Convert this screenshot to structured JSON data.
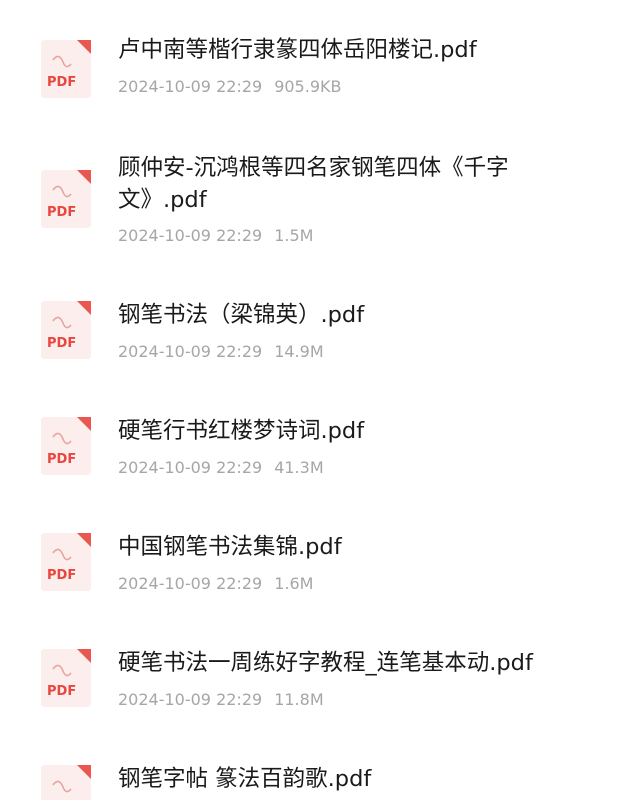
{
  "icon_name": "pdf-file-icon",
  "icon_label": "PDF",
  "colors": {
    "accent": "#e8463f",
    "title": "#1a1a1a",
    "meta": "#a6a6a6"
  },
  "files": [
    {
      "name": "卢中南等楷行隶篆四体岳阳楼记.pdf",
      "date": "2024-10-09 22:29",
      "size": "905.9KB"
    },
    {
      "name": "顾仲安-沉鸿根等四名家钢笔四体《千字文》.pdf",
      "date": "2024-10-09 22:29",
      "size": "1.5M"
    },
    {
      "name": "钢笔书法（梁锦英）.pdf",
      "date": "2024-10-09 22:29",
      "size": "14.9M"
    },
    {
      "name": "硬笔行书红楼梦诗词.pdf",
      "date": "2024-10-09 22:29",
      "size": "41.3M"
    },
    {
      "name": "中国钢笔书法集锦.pdf",
      "date": "2024-10-09 22:29",
      "size": "1.6M"
    },
    {
      "name": "硬笔书法一周练好字教程_连笔基本动.pdf",
      "date": "2024-10-09 22:29",
      "size": "11.8M"
    },
    {
      "name": "钢笔字帖 篆法百韵歌.pdf",
      "date": "",
      "size": ""
    }
  ]
}
